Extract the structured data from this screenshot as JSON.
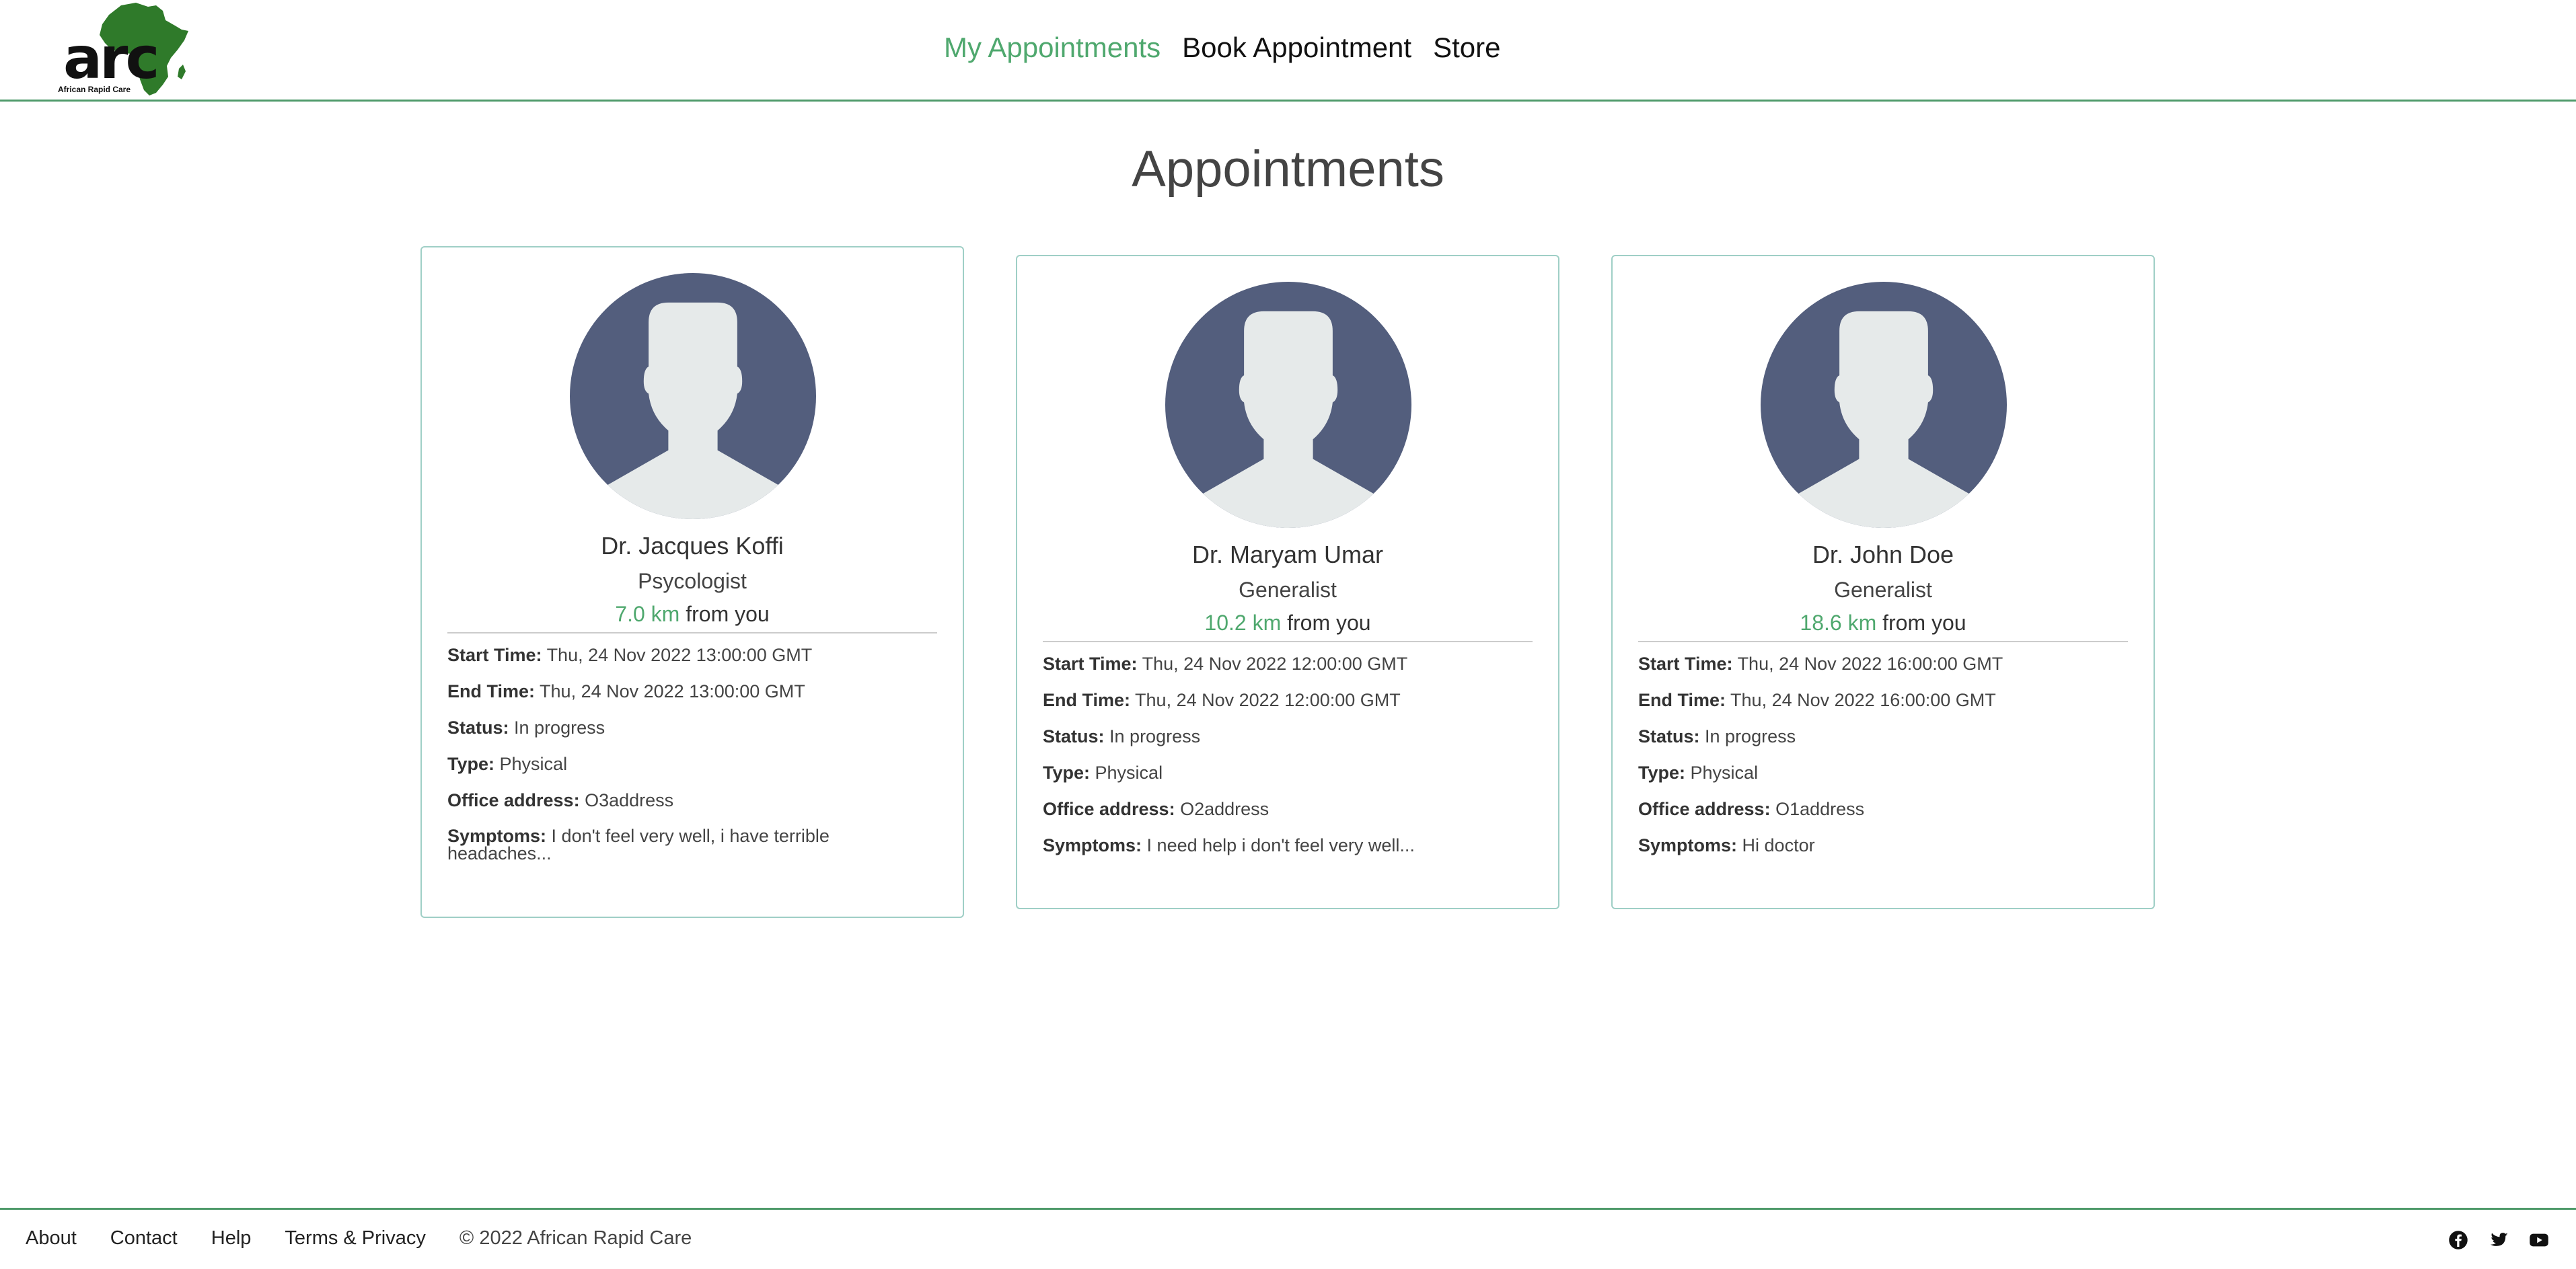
{
  "header": {
    "logo_text": "arc",
    "logo_subtitle": "African Rapid Care",
    "nav": [
      {
        "label": "My Appointments",
        "active": true
      },
      {
        "label": "Book Appointment",
        "active": false
      },
      {
        "label": "Store",
        "active": false
      }
    ]
  },
  "page_title": "Appointments",
  "labels": {
    "start": "Start Time:",
    "end": "End Time:",
    "status": "Status:",
    "type": "Type:",
    "office": "Office address:",
    "symptoms": "Symptoms:",
    "from_you": "from you"
  },
  "appointments": [
    {
      "doctor": "Dr. Jacques Koffi",
      "specialty": "Psycologist",
      "distance": "7.0 km",
      "start_time": "Thu, 24 Nov 2022 13:00:00 GMT",
      "end_time": "Thu, 24 Nov 2022 13:00:00 GMT",
      "status": "In progress",
      "type": "Physical",
      "office_address": "O3address",
      "symptoms": "I don't feel very well, i have terrible headaches..."
    },
    {
      "doctor": "Dr. Maryam Umar",
      "specialty": "Generalist",
      "distance": "10.2 km",
      "start_time": "Thu, 24 Nov 2022 12:00:00 GMT",
      "end_time": "Thu, 24 Nov 2022 12:00:00 GMT",
      "status": "In progress",
      "type": "Physical",
      "office_address": "O2address",
      "symptoms": "I need help i don't feel very well..."
    },
    {
      "doctor": "Dr. John Doe",
      "specialty": "Generalist",
      "distance": "18.6 km",
      "start_time": "Thu, 24 Nov 2022 16:00:00 GMT",
      "end_time": "Thu, 24 Nov 2022 16:00:00 GMT",
      "status": "In progress",
      "type": "Physical",
      "office_address": "O1address",
      "symptoms": "Hi doctor"
    }
  ],
  "footer": {
    "links": [
      "About",
      "Contact",
      "Help",
      "Terms & Privacy"
    ],
    "copyright": "© 2022 African Rapid Care",
    "social_icons": [
      "facebook-icon",
      "twitter-icon",
      "youtube-icon"
    ]
  },
  "colors": {
    "brand_green": "#4fa86e",
    "header_rule": "#4e9a6a",
    "card_border": "#9fcfc6",
    "avatar_bg": "#535e7d",
    "avatar_fg": "#e6eaea"
  }
}
